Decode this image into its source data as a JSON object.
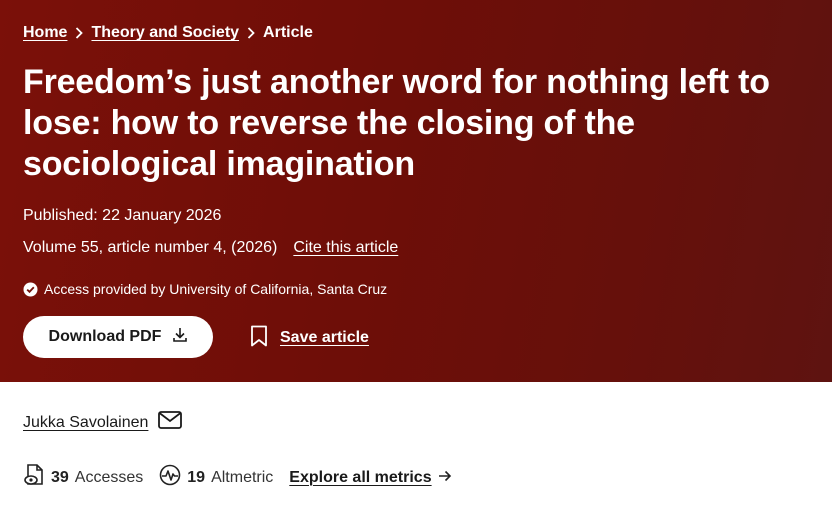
{
  "breadcrumb": {
    "items": [
      {
        "label": "Home"
      },
      {
        "label": "Theory and Society"
      },
      {
        "label": "Article"
      }
    ]
  },
  "article": {
    "title": "Freedom’s just another word for nothing left to lose: how to reverse the closing of the sociological imagination",
    "published": "Published: 22 January 2026",
    "volume": "Volume 55, article number 4, (2026)",
    "cite_label": "Cite this article",
    "access": "Access provided by University of California, Santa Cruz"
  },
  "actions": {
    "download_label": "Download PDF",
    "save_label": "Save article"
  },
  "author": {
    "name": "Jukka Savolainen"
  },
  "metrics": {
    "accesses_count": "39",
    "accesses_label": "Accesses",
    "altmetric_count": "19",
    "altmetric_label": "Altmetric",
    "explore_label": "Explore all metrics"
  },
  "colors": {
    "hero_background": "#741009",
    "button_background": "#ffffff",
    "text_dark": "#1a1a1a"
  },
  "icons": [
    "chevron-right-icon",
    "check-circle-icon",
    "download-icon",
    "bookmark-icon",
    "mail-icon",
    "accesses-icon",
    "altmetric-icon",
    "arrow-right-icon"
  ]
}
